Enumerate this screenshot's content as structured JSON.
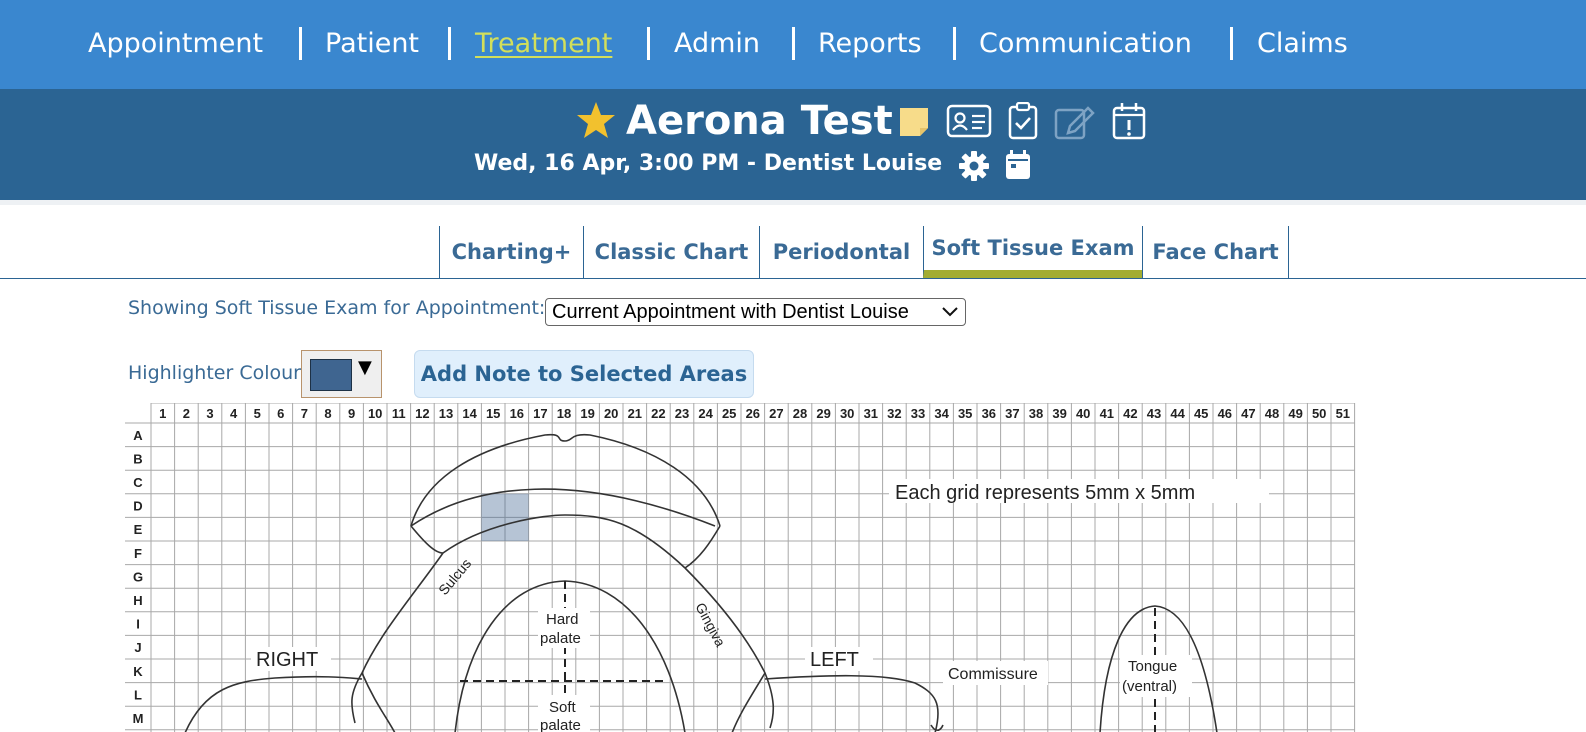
{
  "nav": {
    "items": [
      "Appointment",
      "Patient",
      "Treatment",
      "Admin",
      "Reports",
      "Communication",
      "Claims"
    ],
    "active": "Treatment"
  },
  "patient": {
    "name": "Aerona Test",
    "appointment": "Wed, 16 Apr, 3:00 PM -  Dentist Louise"
  },
  "tabs": {
    "items": [
      "Charting+",
      "Classic Chart",
      "Periodontal",
      "Soft Tissue Exam",
      "Face Chart"
    ],
    "active": "Soft Tissue Exam"
  },
  "exam": {
    "showing_label": "Showing Soft Tissue Exam for Appointment:",
    "appointment_select": "Current Appointment with Dentist Louise",
    "highlighter_label": "Highlighter Colour",
    "highlighter_color": "#3f6590",
    "add_note_button": "Add Note to Selected Areas"
  },
  "grid": {
    "columns": [
      "1",
      "2",
      "3",
      "4",
      "5",
      "6",
      "7",
      "8",
      "9",
      "10",
      "11",
      "12",
      "13",
      "14",
      "15",
      "16",
      "17",
      "18",
      "19",
      "20",
      "21",
      "22",
      "23",
      "24",
      "25",
      "26",
      "27",
      "28",
      "29",
      "30",
      "31",
      "32",
      "33",
      "34",
      "35",
      "36",
      "37",
      "38",
      "39",
      "40",
      "41",
      "42",
      "43",
      "44",
      "45",
      "46",
      "47",
      "48",
      "49",
      "50",
      "51"
    ],
    "rows": [
      "A",
      "B",
      "C",
      "D",
      "E",
      "F",
      "G",
      "H",
      "I",
      "J",
      "K",
      "L",
      "M"
    ],
    "scale_note": "Each grid represents 5mm x 5mm",
    "highlighted_cells": [
      "D15",
      "D16",
      "E15",
      "E16"
    ],
    "labels": {
      "right": "RIGHT",
      "left": "LEFT",
      "sulcus": "Sulcus",
      "gingiva": "Gingiva",
      "hard_palate_1": "Hard",
      "hard_palate_2": "palate",
      "soft_palate_1": "Soft",
      "soft_palate_2": "palate",
      "commissure": "Commissure",
      "tongue_1": "Tongue",
      "tongue_2": "(ventral)"
    }
  },
  "colors": {
    "nav_bg": "#3a87cf",
    "header_bg": "#2b6493",
    "active_nav": "#d3df5a",
    "active_tab_underline": "#a2ad32",
    "star": "#f2c12e",
    "note_icon": "#f7dc8a"
  },
  "icons": [
    "star-icon",
    "sticky-note-icon",
    "contact-card-icon",
    "clipboard-check-icon",
    "edit-icon",
    "calendar-alert-icon",
    "gear-icon",
    "calendar-icon"
  ]
}
